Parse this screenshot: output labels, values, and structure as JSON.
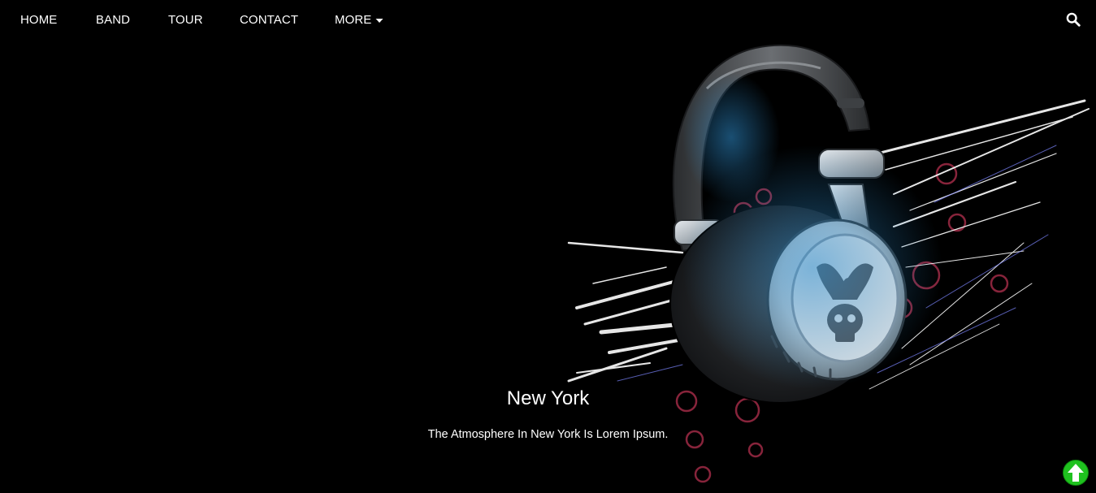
{
  "nav": {
    "items": [
      {
        "label": "HOME"
      },
      {
        "label": "BAND"
      },
      {
        "label": "TOUR"
      },
      {
        "label": "CONTACT"
      },
      {
        "label": "MORE"
      }
    ],
    "more_icon": "caret-down-icon",
    "search_icon": "search-icon"
  },
  "hero": {
    "image": "headphones-with-skull-emblem",
    "title": "New York",
    "text": "The Atmosphere In New York Is Lorem Ipsum."
  },
  "scroll_top": {
    "icon": "arrow-up-circle-icon",
    "color": "#1fc21f"
  },
  "colors": {
    "background": "#000000",
    "text": "#ffffff",
    "accent_blue": "#3a9fd8",
    "accent_pink": "#c0335a"
  }
}
